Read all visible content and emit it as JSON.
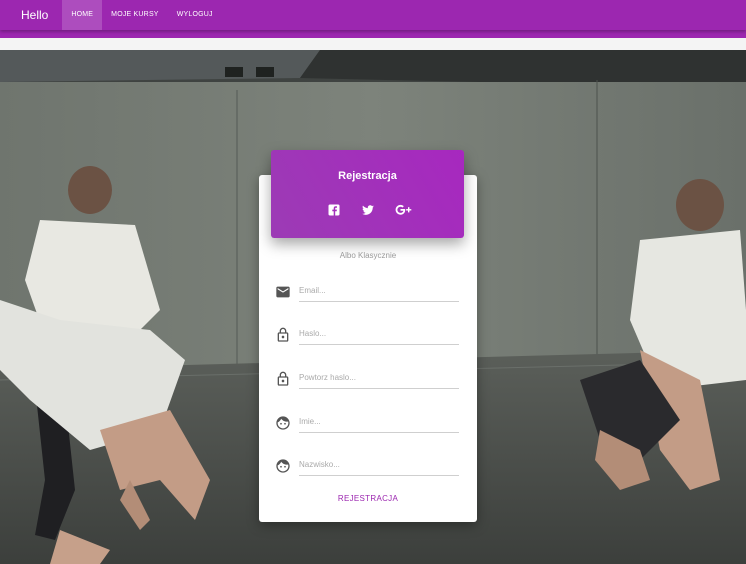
{
  "navbar": {
    "brand": "Hello",
    "links": [
      {
        "label": "HOME",
        "active": true
      },
      {
        "label": "MOJE KURSY",
        "active": false
      },
      {
        "label": "WYLOGUJ",
        "active": false
      }
    ]
  },
  "form": {
    "title": "Rejestracja",
    "social": [
      "facebook-icon",
      "twitter-icon",
      "google-plus-icon"
    ],
    "divider": "Albo Klasycznie",
    "fields": [
      {
        "name": "email-field",
        "icon": "email-icon",
        "placeholder": "Email..."
      },
      {
        "name": "password-field",
        "icon": "lock-icon",
        "placeholder": "Haslo..."
      },
      {
        "name": "repeat-password-field",
        "icon": "lock-icon",
        "placeholder": "Powtorz haslo..."
      },
      {
        "name": "first-name-field",
        "icon": "face-icon",
        "placeholder": "Imie..."
      },
      {
        "name": "last-name-field",
        "icon": "face-icon",
        "placeholder": "Nazwisko..."
      }
    ],
    "submit_label": "REJESTRACJA"
  },
  "colors": {
    "accent": "#9c27b0",
    "icon": "#555555"
  }
}
